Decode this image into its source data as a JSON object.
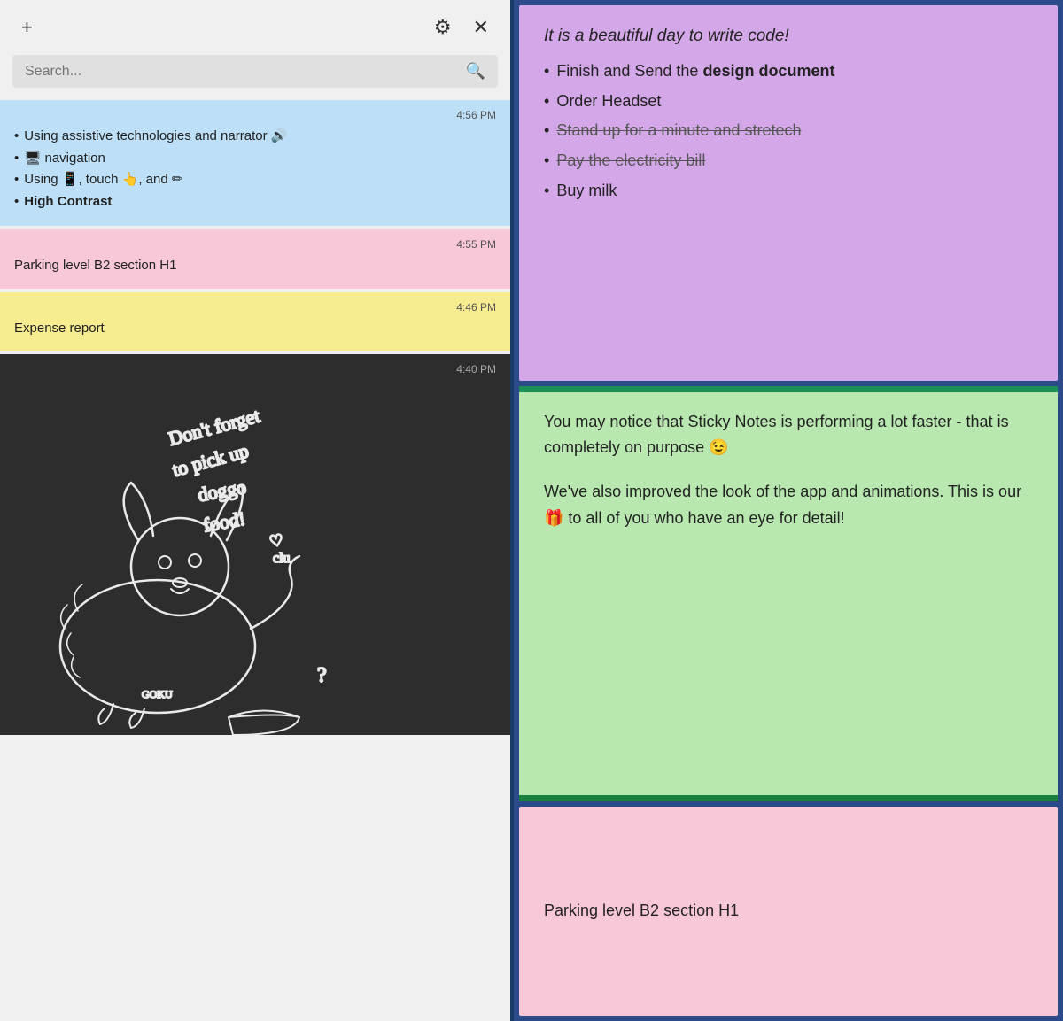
{
  "toolbar": {
    "add_label": "+",
    "settings_label": "⚙",
    "close_label": "✕"
  },
  "search": {
    "placeholder": "Search...",
    "icon": "🔍"
  },
  "notes": [
    {
      "id": "note-blue",
      "color": "blue",
      "time": "4:56 PM",
      "bullets": [
        {
          "text": "Using assistive technologies and narrator 🔊"
        },
        {
          "text": "🖥 navigation"
        },
        {
          "text": "Using 📱, touch 👆, and ✏"
        },
        {
          "text": "High Contrast",
          "bold": true
        }
      ]
    },
    {
      "id": "note-pink",
      "color": "pink",
      "time": "4:55 PM",
      "text": "Parking level B2 section H1"
    },
    {
      "id": "note-yellow",
      "color": "yellow",
      "time": "4:46 PM",
      "text": "Expense report"
    },
    {
      "id": "note-dark",
      "color": "dark",
      "time": "4:40 PM",
      "text": "doggo drawing"
    }
  ],
  "right_notes": [
    {
      "id": "rn-purple",
      "color": "purple",
      "title": "It is a beautiful day to write code!",
      "bullets": [
        {
          "text": "Finish and Send the ",
          "bold_part": "design document",
          "strikethrough": false
        },
        {
          "text": "Order Headset",
          "strikethrough": false
        },
        {
          "text": "Stand up for a minute and stretech",
          "strikethrough": true
        },
        {
          "text": "Pay the electricity bill",
          "strikethrough": true
        },
        {
          "text": "Buy milk",
          "strikethrough": false
        }
      ]
    },
    {
      "id": "rn-green",
      "color": "green",
      "paragraphs": [
        "You may notice that Sticky Notes is performing a lot faster - that is completely on purpose 😉",
        "We've also improved the look of the app and animations. This is our 🎁 to all of you who have an eye for detail!"
      ]
    },
    {
      "id": "rn-pink",
      "color": "pink",
      "text": "Parking level B2 section H1"
    }
  ]
}
